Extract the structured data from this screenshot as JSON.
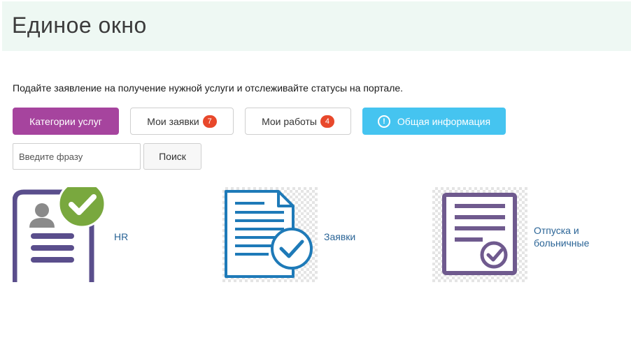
{
  "header": {
    "title": "Единое окно"
  },
  "intro_text": "Подайте заявление на получение нужной услуги и отслеживайте статусы на портале.",
  "actions": {
    "categories_label": "Категории услуг",
    "my_requests_label": "Мои заявки",
    "my_requests_count": "7",
    "my_works_label": "Мои работы",
    "my_works_count": "4",
    "general_info_label": "Общая информация"
  },
  "search": {
    "placeholder": "Введите фразу",
    "value": "",
    "button_label": "Поиск"
  },
  "tiles": [
    {
      "label": "HR",
      "icon": "hr-profile-check-icon"
    },
    {
      "label": "Заявки",
      "icon": "document-check-icon"
    },
    {
      "label_line1": "Отпуска и",
      "label_line2": "больничные",
      "icon": "vacation-document-check-icon"
    }
  ],
  "colors": {
    "header_bg": "#eef8f3",
    "primary_purple": "#a6449e",
    "info_blue": "#45c4f0",
    "badge_red": "#e8482b",
    "link_blue": "#2a6496",
    "hr_icon_purple": "#5a4e8c",
    "hr_icon_green": "#79a83e",
    "requests_icon_blue": "#1e7ab8",
    "vacation_icon_purple": "#6f5a8e"
  }
}
